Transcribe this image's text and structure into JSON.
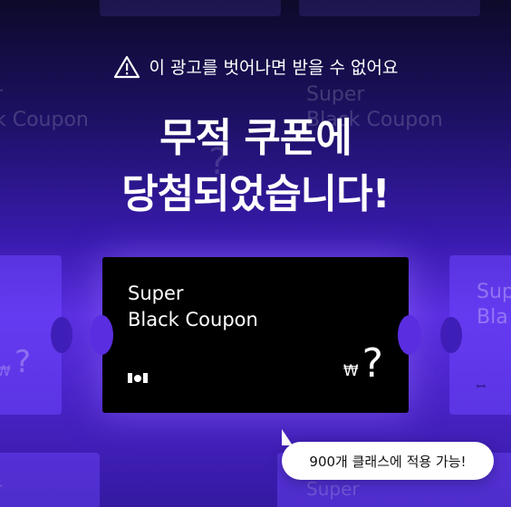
{
  "warning": {
    "icon": "warning-triangle-icon",
    "text": "이 광고를 벗어나면 받을 수 없어요"
  },
  "headline": {
    "line1": "무적 쿠폰에",
    "line2": "당첨되었습니다!"
  },
  "coupon": {
    "title_line1": "Super",
    "title_line2": "Black Coupon",
    "currency": "₩",
    "price": "?",
    "logo": "brand-logo-icon"
  },
  "bubble": {
    "text": "900개 클래스에 적용 가능!"
  },
  "background": {
    "ghost_title_line1": "Super",
    "ghost_title_line2": "Black Coupon",
    "ghost_left_partial": "r",
    "ghost_left_partial2": "k Coupon",
    "ghost_right_partial": "Sup",
    "ghost_right_partial2": "Bla",
    "ghost_bottom_right": "Super",
    "ghost_price": "?",
    "ghost_currency": "₩"
  },
  "colors": {
    "accent": "#5b2fe0",
    "coupon": "#000000",
    "text": "#ffffff"
  }
}
